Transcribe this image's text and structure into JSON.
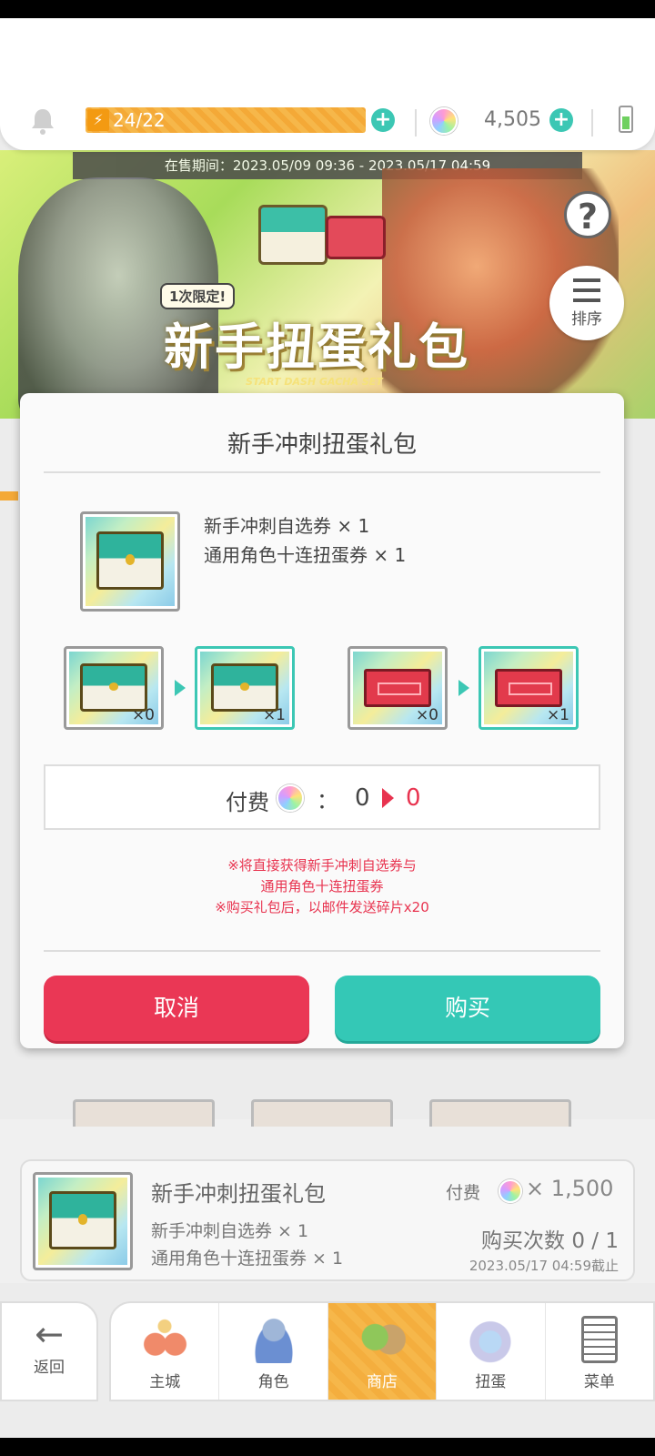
{
  "header": {
    "stamina": "24/22",
    "gems": "4,505"
  },
  "banner": {
    "sale_period": "在售期间：2023.05/09 09:36 - 2023.05/17 04:59",
    "limit_tag": "1次限定!",
    "title": "新手扭蛋礼包",
    "subtitle": "START DASH GACHA SET",
    "help_icon": "question-icon",
    "sort_label": "排序"
  },
  "dialog": {
    "title": "新手冲刺扭蛋礼包",
    "contents": [
      "新手冲刺自选券 × 1",
      "通用角色十连扭蛋券 × 1"
    ],
    "conversions": [
      {
        "item": "selection-ticket",
        "from": "×0",
        "to": "×1"
      },
      {
        "item": "gacha-ticket",
        "from": "×0",
        "to": "×1"
      }
    ],
    "price_label": "付费",
    "price_colon": "：",
    "price_from": "0",
    "price_to": "0",
    "notes": [
      "※将直接获得新手冲刺自选券与",
      "通用角色十连扭蛋券",
      "※购买礼包后，以邮件发送碎片x20"
    ],
    "cancel_label": "取消",
    "buy_label": "购买"
  },
  "product": {
    "name": "新手冲刺扭蛋礼包",
    "price_label": "付费",
    "price": "× 1,500",
    "line1": "新手冲刺自选券 × 1",
    "line2": "通用角色十连扭蛋券 × 1",
    "purchase_count": "购买次数 0 / 1",
    "deadline": "2023.05/17 04:59截止"
  },
  "nav": {
    "back": "返回",
    "tabs": [
      "主城",
      "角色",
      "商店",
      "扭蛋",
      "菜单"
    ],
    "active_tab": "商店"
  },
  "colors": {
    "accent_teal": "#34c8b6",
    "accent_red": "#ea3755",
    "stamina_orange": "#f4a937"
  }
}
